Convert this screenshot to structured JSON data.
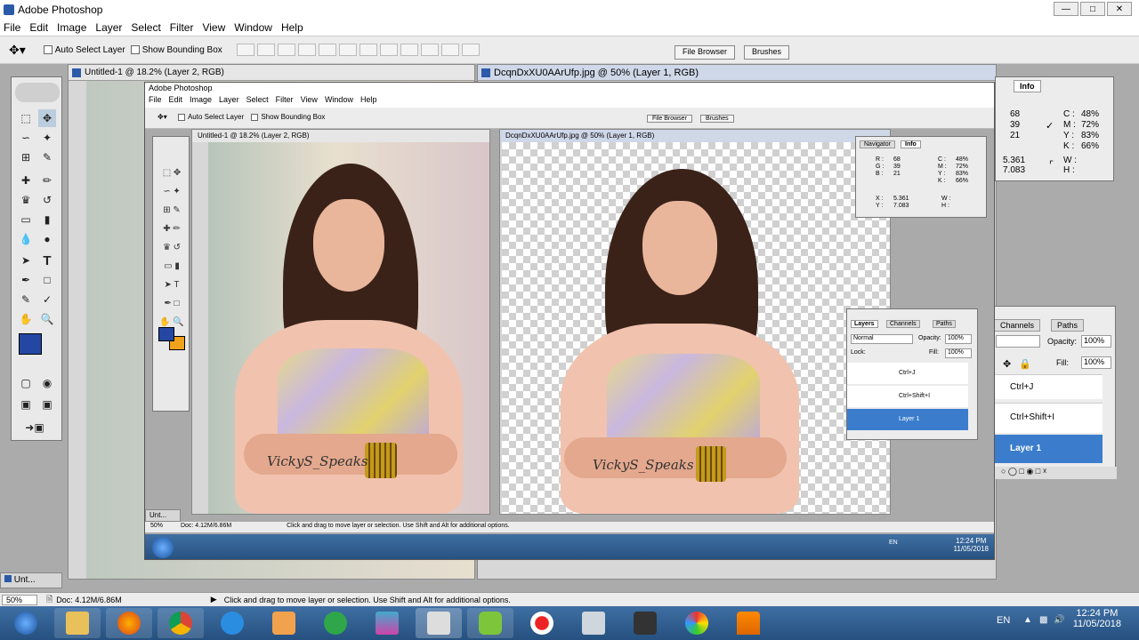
{
  "app": {
    "title": "Adobe Photoshop"
  },
  "menu": [
    "File",
    "Edit",
    "Image",
    "Layer",
    "Select",
    "Filter",
    "View",
    "Window",
    "Help"
  ],
  "options": {
    "auto_select": "Auto Select Layer",
    "show_bounding": "Show Bounding Box",
    "file_browser": "File Browser",
    "brushes": "Brushes"
  },
  "doc1": {
    "title": "Untitled-1 @ 18.2% (Layer 2, RGB)"
  },
  "doc2": {
    "title": "DcqnDxXU0AArUfp.jpg @ 50% (Layer 1, RGB)"
  },
  "minimized_doc": "Unt...",
  "inner_minimized_doc": "Unt...",
  "inner": {
    "app_title": "Adobe Photoshop",
    "status_zoom": "50%",
    "status_doc": "Doc: 4.12M/6.86M",
    "status_hint": "Click and drag to move layer or selection.  Use Shift and Alt for additional options.",
    "time": "12:24 PM",
    "date": "11/05/2018",
    "lang": "EN"
  },
  "info": {
    "tabs": [
      "Navigator",
      "Info"
    ],
    "r": "68",
    "g": "39",
    "b": "21",
    "c": "48%",
    "m": "72%",
    "y": "83%",
    "k": "66%",
    "rgb_labels": [
      "R :",
      "G :",
      "B :"
    ],
    "cmyk_labels": [
      "C :",
      "M :",
      "Y :",
      "K :"
    ],
    "x": "5.361",
    "yy": "7.083",
    "xy_labels": [
      "X :",
      "Y :"
    ],
    "wh_labels": [
      "W :",
      "H :"
    ]
  },
  "layers": {
    "tabs": [
      "Layers",
      "Channels",
      "Paths"
    ],
    "blend": "Normal",
    "opacity_label": "Opacity:",
    "opacity": "100%",
    "lock_label": "Lock:",
    "fill_label": "Fill:",
    "fill": "100%",
    "items": [
      "Ctrl+J",
      "Ctrl+Shift+I",
      "Layer 1"
    ]
  },
  "signature": "VickyS_Speaks",
  "status": {
    "zoom": "50%",
    "doc": "Doc: 4.12M/6.86M",
    "hint": "Click and drag to move layer or selection.  Use Shift and Alt for additional options."
  },
  "taskbar": {
    "lang": "EN",
    "time": "12:24 PM",
    "date": "11/05/2018"
  },
  "colors": {
    "fg": "#2447a3",
    "bg": "#f0a21c",
    "taskbar": "#2a5d96",
    "selected_layer": "#3b7dcc"
  }
}
